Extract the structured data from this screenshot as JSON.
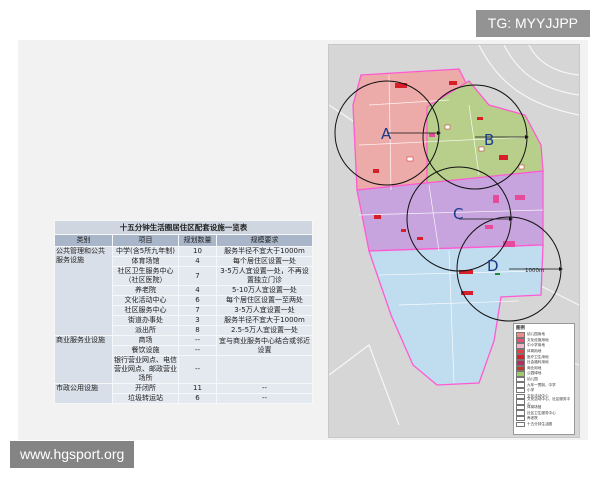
{
  "watermark_tg": "TG: MYYJJPP",
  "watermark_site": "www.hgsport.org",
  "table": {
    "title": "十五分钟生活圈居住区配套设施一览表",
    "headers": [
      "类别",
      "项目",
      "规划数量",
      "规模要求"
    ],
    "groups": [
      {
        "category": "公共管理和公共服务设施",
        "rows": [
          {
            "item": "中学(含5所九年制)",
            "count": "10",
            "req": "服务半径不宜大于1000m"
          },
          {
            "item": "体育场馆",
            "count": "4",
            "req": "每个居住区设置一处"
          },
          {
            "item": "社区卫生服务中心（社区医院）",
            "count": "7",
            "req": "3-5万人宜设置一处，不再设置独立门诊"
          },
          {
            "item": "养老院",
            "count": "4",
            "req": "5-10万人宜设置一处"
          },
          {
            "item": "文化活动中心",
            "count": "6",
            "req": "每个居住区设置一至两处"
          },
          {
            "item": "社区服务中心",
            "count": "7",
            "req": "3-5万人宜设置一处"
          },
          {
            "item": "街道办事处",
            "count": "3",
            "req": "服务半径不宜大于1000m"
          },
          {
            "item": "派出所",
            "count": "8",
            "req": "2.5-5万人宜设置一处"
          }
        ]
      },
      {
        "category": "商业服务业设施",
        "rows": [
          {
            "item": "商场",
            "count": "--",
            "req": "宜与商业服务中心结合或邻近设置"
          },
          {
            "item": "餐饮设施",
            "count": "--",
            "req": ""
          },
          {
            "item": "银行营业网点、电信营业网点、邮政营业场所",
            "count": "--",
            "req": ""
          }
        ]
      },
      {
        "category": "市政公用设施",
        "rows": [
          {
            "item": "开闭所",
            "count": "11",
            "req": "--"
          },
          {
            "item": "垃圾转运站",
            "count": "6",
            "req": "--"
          }
        ]
      }
    ]
  },
  "map": {
    "zones": [
      "A",
      "B",
      "C",
      "D"
    ],
    "distance_label": "1000m",
    "legend_title": "图例",
    "legend_items": [
      {
        "label": "幼儿园用地",
        "color": "#f28a8a"
      },
      {
        "label": "文化设施用地",
        "color": "#e8507a"
      },
      {
        "label": "中小学用地",
        "color": "#f5b5c8"
      },
      {
        "label": "体育用地",
        "color": "#e64040"
      },
      {
        "label": "医疗卫生用地",
        "color": "#d81e28"
      },
      {
        "label": "社会福利用地",
        "color": "#b23060"
      },
      {
        "label": "商业用地",
        "color": "#c0392b"
      },
      {
        "label": "公园绿地",
        "color": "#9ecb6a"
      },
      {
        "label": "幼儿园",
        "color": "#ffffff"
      },
      {
        "label": "九年一贯制、中学",
        "color": "#ffffff"
      },
      {
        "label": "小学",
        "color": "#ffffff"
      },
      {
        "label": "文化活动中心",
        "color": "#ffffff"
      },
      {
        "label": "文化活动中心、社区服务中心",
        "color": "#ffffff"
      },
      {
        "label": "体育场馆",
        "color": "#ffffff"
      },
      {
        "label": "社区卫生服务中心",
        "color": "#ffffff"
      },
      {
        "label": "养老院",
        "color": "#ffffff"
      },
      {
        "label": "十五分钟生活圈",
        "color": "#ffffff"
      }
    ]
  }
}
